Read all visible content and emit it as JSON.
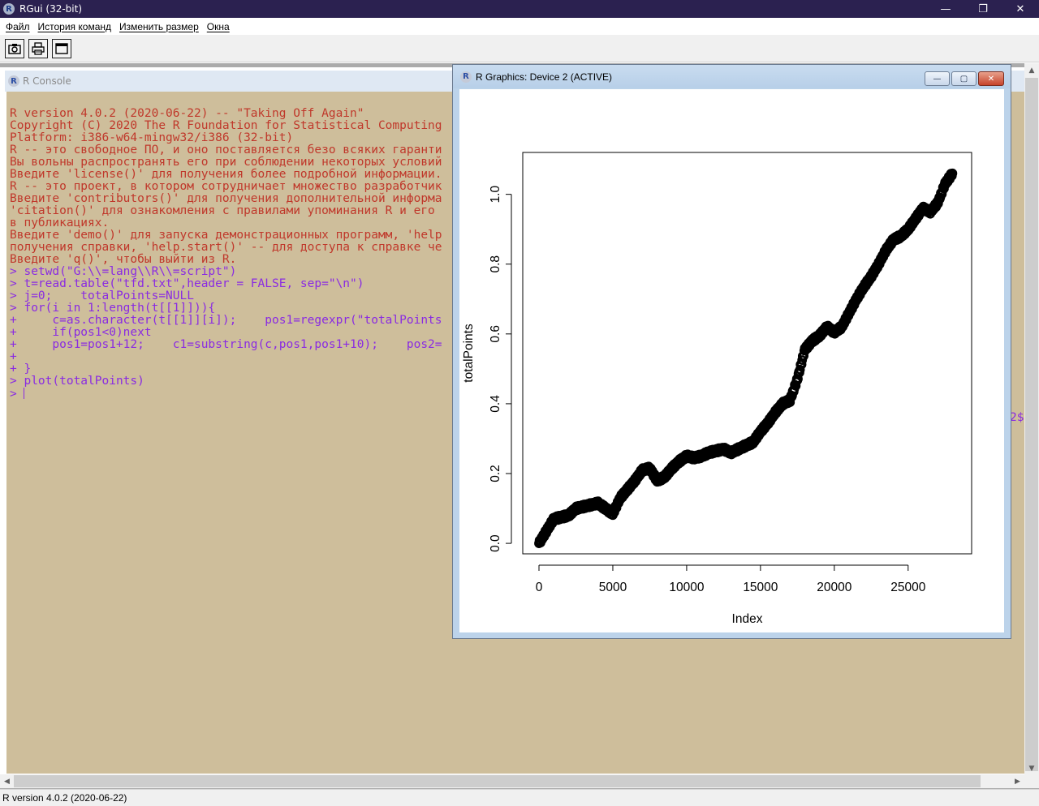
{
  "window": {
    "title": "RGui (32-bit)",
    "minimize_glyph": "—",
    "maximize_glyph": "❐",
    "close_glyph": "✕"
  },
  "menu": {
    "items": [
      "Файл",
      "История команд",
      "Изменить размер",
      "Окна"
    ]
  },
  "toolbar": {
    "buttons": [
      "camera-icon",
      "printer-icon",
      "window-icon"
    ]
  },
  "console": {
    "title": "R Console",
    "lines": [
      {
        "kind": "out",
        "text": "R version 4.0.2 (2020-06-22) -- \"Taking Off Again\""
      },
      {
        "kind": "out",
        "text": "Copyright (C) 2020 The R Foundation for Statistical Computing"
      },
      {
        "kind": "out",
        "text": "Platform: i386-w64-mingw32/i386 (32-bit)"
      },
      {
        "kind": "out",
        "text": ""
      },
      {
        "kind": "out",
        "text": "R -- это свободное ПО, и оно поставляется безо всяких гаранти"
      },
      {
        "kind": "out",
        "text": "Вы вольны распространять его при соблюдении некоторых условий"
      },
      {
        "kind": "out",
        "text": "Введите 'license()' для получения более подробной информации."
      },
      {
        "kind": "out",
        "text": ""
      },
      {
        "kind": "out",
        "text": "R -- это проект, в котором сотрудничает множество разработчик"
      },
      {
        "kind": "out",
        "text": "Введите 'contributors()' для получения дополнительной информа"
      },
      {
        "kind": "out",
        "text": "'citation()' для ознакомления с правилами упоминания R и его"
      },
      {
        "kind": "out",
        "text": "в публикациях."
      },
      {
        "kind": "out",
        "text": ""
      },
      {
        "kind": "out",
        "text": "Введите 'demo()' для запуска демонстрационных программ, 'help"
      },
      {
        "kind": "out",
        "text": "получения справки, 'help.start()' -- для доступа к справке че"
      },
      {
        "kind": "out",
        "text": "Введите 'q()', чтобы выйти из R."
      },
      {
        "kind": "out",
        "text": ""
      },
      {
        "kind": "in",
        "text": "> setwd(\"G:\\\\=lang\\\\R\\\\=script\")"
      },
      {
        "kind": "in",
        "text": "> t=read.table(\"tfd.txt\",header = FALSE, sep=\"\\n\")"
      },
      {
        "kind": "in",
        "text": "> j=0;    totalPoints=NULL"
      },
      {
        "kind": "in",
        "text": "> for(i in 1:length(t[[1]])){"
      },
      {
        "kind": "cont",
        "text": "+     c=as.character(t[[1]][i]);    pos1=regexpr(\"totalPoints"
      },
      {
        "kind": "cont",
        "text": "+     if(pos1<0)next"
      },
      {
        "kind": "cont",
        "text": "+     pos1=pos1+12;    c1=substring(c,pos1,pos1+10);    pos2="
      },
      {
        "kind": "cont",
        "text": "+"
      },
      {
        "kind": "cont",
        "text": "+ }"
      },
      {
        "kind": "in",
        "text": "> plot(totalPoints)"
      },
      {
        "kind": "in",
        "text": "> "
      }
    ],
    "overflow_text": "2$"
  },
  "graphics": {
    "title": "R Graphics: Device 2 (ACTIVE)",
    "btn_min": "—",
    "btn_max": "▢",
    "btn_close": "✕"
  },
  "chart_data": {
    "type": "scatter",
    "xlabel": "Index",
    "ylabel": "totalPoints",
    "xlim": [
      -1100,
      29300
    ],
    "ylim": [
      -0.03,
      1.12
    ],
    "x_ticks": [
      0,
      5000,
      10000,
      15000,
      20000,
      25000
    ],
    "y_ticks": [
      0.0,
      0.2,
      0.4,
      0.6,
      0.8,
      1.0
    ],
    "x_tick_labels": [
      "0",
      "5000",
      "10000",
      "15000",
      "20000",
      "25000"
    ],
    "y_tick_labels": [
      "0.0",
      "0.2",
      "0.4",
      "0.6",
      "0.8",
      "1.0"
    ],
    "grid": false,
    "series": [
      {
        "x": [
          0,
          500,
          1000,
          1500,
          2000,
          2500,
          3000,
          3500,
          4000,
          4500,
          5000,
          5500,
          6000,
          6500,
          7000,
          7500,
          8000,
          8500,
          9000,
          9500,
          10000,
          10500,
          11000,
          11500,
          12000,
          12500,
          13000,
          13500,
          14000,
          14500,
          15000,
          15500,
          16000,
          16500,
          17000,
          17500,
          18000,
          18500,
          19000,
          19500,
          20000,
          20500,
          21000,
          21500,
          22000,
          22500,
          23000,
          23500,
          24000,
          24500,
          25000,
          25500,
          26000,
          26500,
          27000,
          27500,
          28000
        ],
        "y": [
          0.0,
          0.035,
          0.07,
          0.075,
          0.08,
          0.1,
          0.105,
          0.11,
          0.115,
          0.1,
          0.085,
          0.13,
          0.155,
          0.18,
          0.21,
          0.215,
          0.18,
          0.19,
          0.215,
          0.235,
          0.25,
          0.245,
          0.25,
          0.26,
          0.265,
          0.27,
          0.26,
          0.27,
          0.28,
          0.29,
          0.32,
          0.345,
          0.375,
          0.4,
          0.41,
          0.47,
          0.555,
          0.58,
          0.595,
          0.62,
          0.605,
          0.62,
          0.66,
          0.7,
          0.735,
          0.765,
          0.8,
          0.84,
          0.87,
          0.88,
          0.9,
          0.93,
          0.96,
          0.95,
          0.975,
          1.03,
          1.06
        ]
      }
    ]
  },
  "status": {
    "text": "R version 4.0.2 (2020-06-22)"
  }
}
